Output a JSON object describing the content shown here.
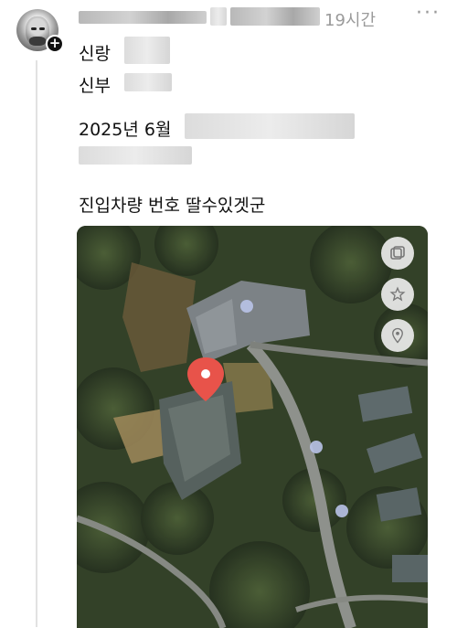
{
  "post": {
    "timestamp": "19시간",
    "more_icon": "more-horizontal-icon",
    "lines": {
      "groom": "신랑",
      "bride": "신부",
      "date": "2025년 6월",
      "comment": "진입차량 번호 딸수있겟군"
    }
  },
  "avatar": {
    "badge": "+"
  },
  "map": {
    "pin_color": "#e8534a",
    "buttons": [
      "map-layers-icon",
      "star-icon",
      "location-pin-icon"
    ]
  }
}
